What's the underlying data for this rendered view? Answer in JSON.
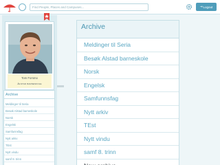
{
  "header": {
    "search_placeholder": "Find People, Places and Campuses...",
    "logout_label": "Logout",
    "icons": [
      "logo-icon",
      "globe-icon",
      "gear-icon",
      "logout-icon"
    ]
  },
  "profile": {
    "name": "Tom Forsmo",
    "school": "Alstad barneskole"
  },
  "sidebar": {
    "title": "Archive",
    "items": [
      "Meldinger til Seria",
      "Besøk Alstad barneskole",
      "Norsk",
      "Engelsk",
      "Samfunnsfag",
      "Nytt arkiv",
      "TEst",
      "Nytt vindu",
      "samf 8. trinn"
    ]
  },
  "archive": {
    "title": "Archive",
    "items": [
      "Meldinger til Seria",
      "Besøk Alstad barneskole",
      "Norsk",
      "Engelsk",
      "Samfunnsfag",
      "Nytt arkiv",
      "TEst",
      "Nytt vindu",
      "samf 8. trinn",
      "New archive"
    ]
  },
  "colors": {
    "accent": "#4f9dba",
    "link": "#5aa7c3",
    "background": "#eef6f8",
    "logo_red": "#e0453f"
  }
}
